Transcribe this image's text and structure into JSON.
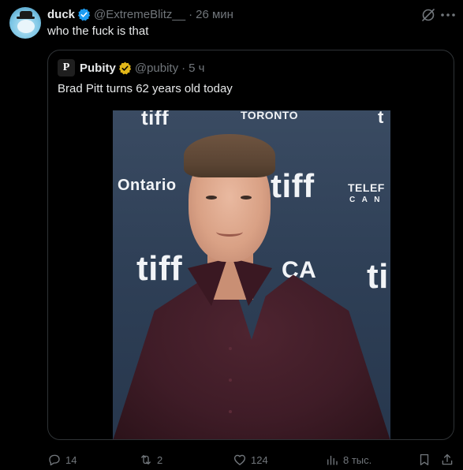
{
  "tweet": {
    "author": {
      "display_name": "duck",
      "handle": "@ExtremeBlitz__",
      "verified": true,
      "avatar_icon": "duck-avatar"
    },
    "time": "26 мин",
    "separator": "·",
    "text": "who the fuck is that"
  },
  "quote": {
    "author": {
      "display_name": "Pubity",
      "avatar_letter": "P",
      "handle": "@pubity",
      "verified_gold": true
    },
    "time": "5 ч",
    "separator": "·",
    "text": "Brad Pitt turns 62 years old today",
    "photo": {
      "backdrop_texts": [
        "tiff",
        "Ontario",
        "tiff",
        "TELEF",
        "C A N",
        "tiff",
        "CA",
        "ti",
        "TORONTO",
        "t"
      ]
    }
  },
  "actions": {
    "replies": "14",
    "reposts": "2",
    "likes": "124",
    "views": "8 тыс."
  },
  "colors": {
    "background": "#000000",
    "text": "#e7e9ea",
    "muted": "#71767b",
    "verified_blue": "#1d9bf0",
    "verified_gold": "#e2b719",
    "border": "#2f3336"
  }
}
